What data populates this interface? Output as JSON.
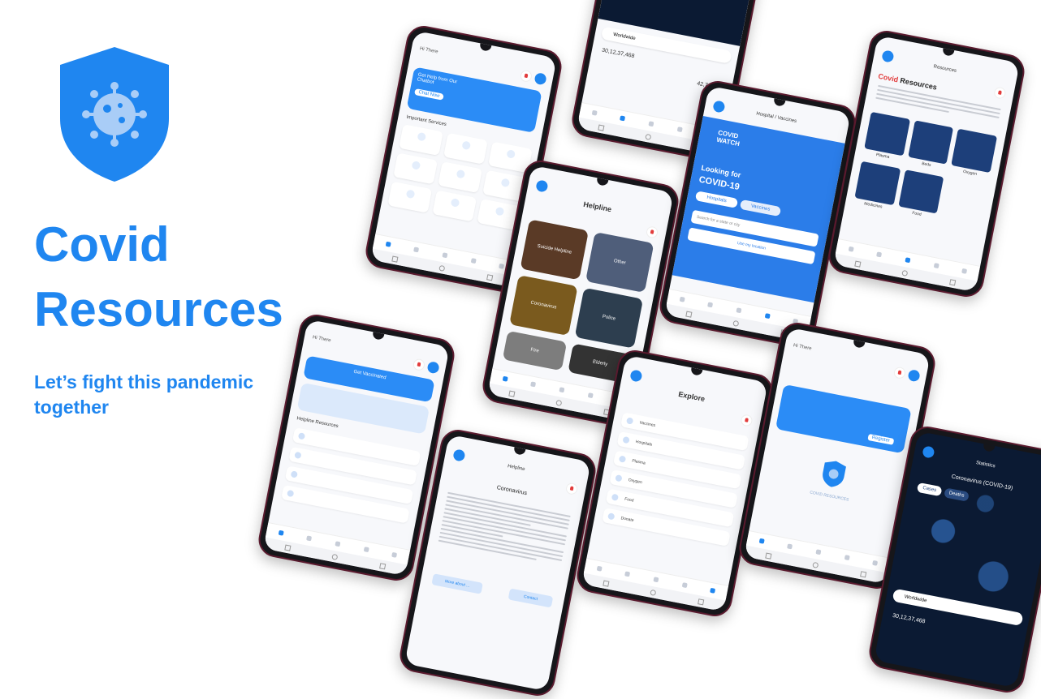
{
  "hero": {
    "title_line1": "Covid",
    "title_line2": "Resources",
    "tagline": "Let’s fight this pandemic together",
    "brand_color": "#1f86f0"
  },
  "phones": {
    "home": {
      "greeting": "Hi There",
      "card_title": "Get Help from Our Chatbot",
      "card_button": "Chat Now",
      "section": "Important Services"
    },
    "stats_top": {
      "search": "Worldwide",
      "confirmed": "30,12,37,468",
      "deaths": "42,72,786"
    },
    "helpline": {
      "title": "Helpline",
      "tiles": [
        "Suicide Helpline",
        "Other",
        "Coronavirus",
        "Police",
        "Fire",
        "Elderly"
      ]
    },
    "hospital": {
      "header": "Hospital / Vaccines",
      "logo": "COVID WATCH",
      "looking_for": "Looking for",
      "covid": "COVID-19",
      "tab_hospitals": "Hospitals",
      "tab_vaccines": "Vaccines",
      "search_placeholder": "Search for a state or city",
      "location_btn": "Use my location"
    },
    "resources": {
      "header": "Resources",
      "title_red": "Covid",
      "title_rest": "Resources",
      "items": [
        "Plasma",
        "Beds",
        "Oxygen",
        "Medicines",
        "Food"
      ]
    },
    "home2": {
      "greeting": "Hi There",
      "card1": "Get Vaccinated",
      "section": "Helpline Resources"
    },
    "article": {
      "header": "Helpline",
      "title": "Coronavirus",
      "btn1": "More about ...",
      "btn2": "Contact"
    },
    "explore": {
      "title": "Explore",
      "items": [
        "Vaccines",
        "Hospitals",
        "Plasma",
        "Oxygen",
        "Food",
        "Donate"
      ]
    },
    "vaccine_home": {
      "greeting": "Hi There",
      "badge_label": "COVID RESOURCES",
      "card_button": "Register"
    },
    "stats_bottom": {
      "header": "Statistics",
      "title": "Coronavirus (COVID-19)",
      "tab_cases": "Cases",
      "tab_deaths": "Deaths",
      "search": "Worldwide",
      "confirmed": "30,12,37,468"
    }
  }
}
